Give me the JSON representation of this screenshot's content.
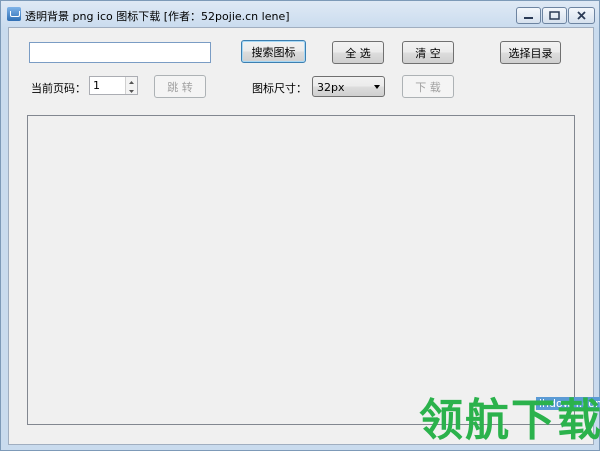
{
  "window": {
    "title": "透明背景 png ico 图标下载 [作者：52pojie.cn lene]"
  },
  "search": {
    "value": "",
    "button": "搜索图标"
  },
  "toolbar": {
    "select_all": "全 选",
    "clear": "清 空",
    "choose_dir": "选择目录"
  },
  "paging": {
    "label": "当前页码：",
    "page": "1",
    "jump": "跳 转"
  },
  "size": {
    "label": "图标尺寸：",
    "selected": "32px",
    "download": "下 载"
  },
  "watermark": {
    "url": "lhdown.com",
    "text": "领航下载"
  },
  "icons": [
    "app-icon",
    "minimize-icon",
    "maximize-icon",
    "close-icon",
    "chevron-down-icon",
    "spin-up-icon",
    "spin-down-icon"
  ]
}
